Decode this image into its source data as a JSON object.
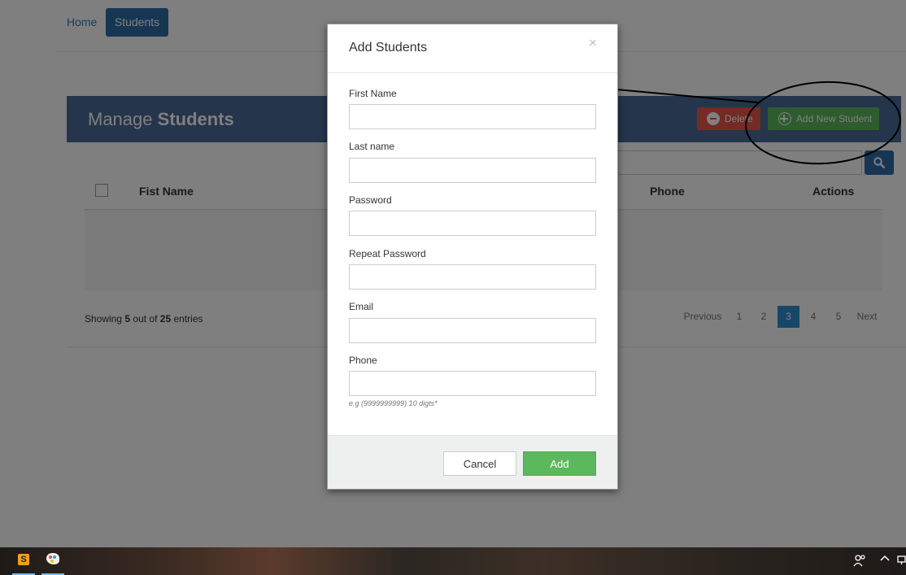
{
  "nav": {
    "home": "Home",
    "students": "Students"
  },
  "panel": {
    "title_prefix": "Manage",
    "title_bold": "Students",
    "delete_label": "Delete",
    "add_new_label": "Add New Student"
  },
  "table": {
    "columns": {
      "first_name": "Fist Name",
      "phone": "Phone",
      "actions": "Actions"
    }
  },
  "footer": {
    "showing_prefix": "Showing",
    "showing_count": "5",
    "showing_mid": "out of",
    "showing_total": "25",
    "showing_suffix": "entries"
  },
  "pagination": {
    "previous": "Previous",
    "pages": [
      "1",
      "2",
      "3",
      "4",
      "5"
    ],
    "active_page": "3",
    "next": "Next"
  },
  "modal": {
    "title": "Add Students",
    "close": "×",
    "fields": {
      "first_name": {
        "label": "First Name",
        "value": ""
      },
      "last_name": {
        "label": "Last name",
        "value": ""
      },
      "password": {
        "label": "Password",
        "value": ""
      },
      "repeat_password": {
        "label": "Repeat Password",
        "value": ""
      },
      "email": {
        "label": "Email",
        "value": ""
      },
      "phone": {
        "label": "Phone",
        "value": ""
      }
    },
    "phone_help": "e.g (9999999999) 10 digts*",
    "cancel_label": "Cancel",
    "add_label": "Add"
  },
  "taskbar": {
    "apps": [
      {
        "icon": "sublime-text-icon",
        "glyph": "S"
      },
      {
        "icon": "paint-icon"
      }
    ]
  },
  "colors": {
    "primary": "#2d6ca8",
    "panel_header": "#4a6a96",
    "success": "#5cb85c",
    "danger": "#e8574d",
    "active_page": "#2d8fd0"
  }
}
